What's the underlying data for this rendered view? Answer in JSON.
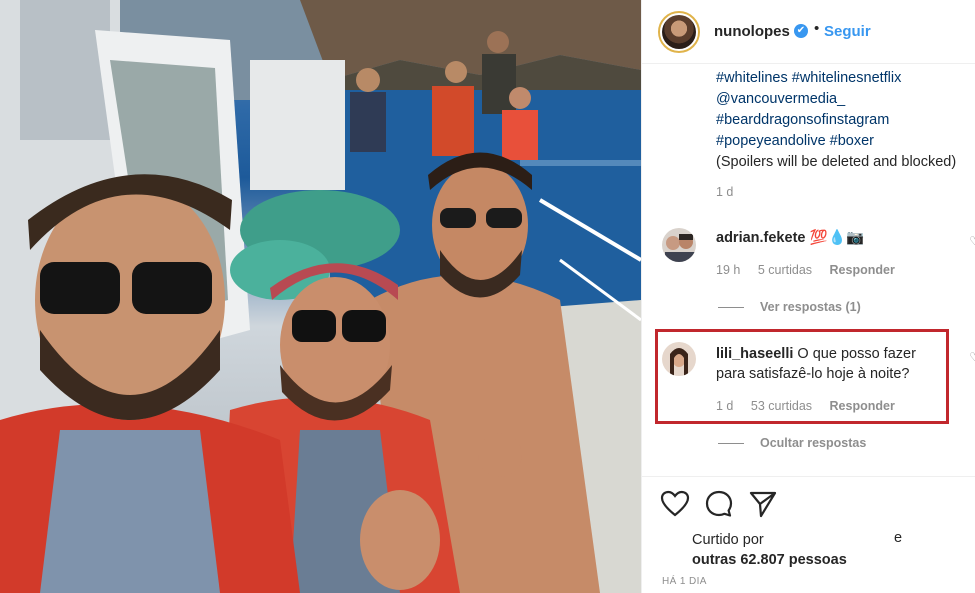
{
  "post": {
    "username": "nunolopes",
    "verified_mark": "✔",
    "separator": "•",
    "follow_label": "Seguir",
    "caption_lines": [
      {
        "text": "#whitelines #whitelinesnetflix",
        "kind": "tag"
      },
      {
        "text": "@vancouvermedia_",
        "kind": "tag"
      },
      {
        "text": "#bearddragonsofinstagram",
        "kind": "tag"
      },
      {
        "text": "#popeyeandolive #boxer",
        "kind": "tag"
      },
      {
        "text": "(Spoilers will be deleted and blocked)",
        "kind": "plain"
      }
    ],
    "caption_time": "1 d"
  },
  "comments": [
    {
      "username": "adrian.fekete",
      "text": "💯💧📷",
      "time": "19 h",
      "likes": "5 curtidas",
      "reply_label": "Responder",
      "replies_label": "Ver respostas (1)"
    },
    {
      "username": "lili_haseelli",
      "text_line1": "O que posso fazer",
      "text_line2": "para satisfazê-lo hoje à noite?",
      "time": "1 d",
      "likes": "53 curtidas",
      "reply_label": "Responder",
      "replies_label": "Ocultar respostas"
    }
  ],
  "actions": {
    "icons": [
      "heart-icon",
      "comment-icon",
      "share-icon"
    ],
    "liked_by_prefix": "Curtido por",
    "liked_by_suffix": "e",
    "liked_by_count": "outras 62.807 pessoas",
    "time_ago": "HÁ 1 DIA"
  },
  "colors": {
    "link": "#3897f0",
    "hashtag": "#003569",
    "highlight_border": "#c1272d",
    "muted": "#8e8e8e"
  }
}
